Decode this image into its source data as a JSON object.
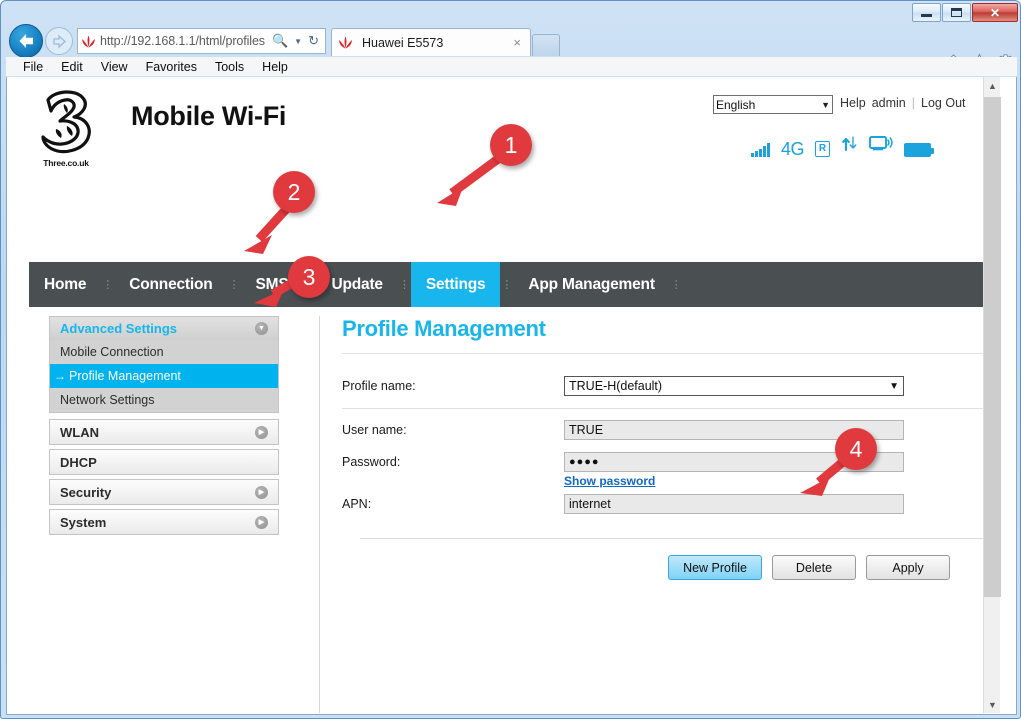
{
  "browser": {
    "window_controls": [
      "minimize",
      "maximize",
      "close"
    ],
    "back_label": "Back",
    "forward_label": "Forward",
    "url": "http://192.168.1.1/html/profiles",
    "url_host": "192.168.1.1",
    "url_scheme": "http://",
    "url_path": "/html/profiles",
    "search_icon": "search-icon",
    "dropdown_icon": "chevron-down-icon",
    "refresh_icon": "refresh-icon",
    "tab": {
      "title": "Huawei E5573",
      "close_label": "×"
    },
    "new_tab_label": "",
    "toolbar_icons": [
      "home-icon",
      "favorites-star-icon",
      "settings-gear-icon"
    ],
    "menu": [
      "File",
      "Edit",
      "View",
      "Favorites",
      "Tools",
      "Help"
    ]
  },
  "header": {
    "logo_text": "Three.co.uk",
    "brand_title": "Mobile Wi-Fi",
    "language": "English",
    "links": {
      "help": "Help",
      "user": "admin",
      "logout": "Log Out"
    },
    "status": {
      "signal": "signal-bars-icon",
      "network": "4G",
      "roaming": "R",
      "traffic": "upload-download-icon",
      "wifi": "wifi-clients-icon",
      "battery": "battery-full-icon"
    }
  },
  "nav": {
    "items": [
      {
        "label": "Home",
        "active": false
      },
      {
        "label": "Connection",
        "active": false
      },
      {
        "label": "SMS",
        "active": false
      },
      {
        "label": "Update",
        "active": false
      },
      {
        "label": "Settings",
        "active": true
      },
      {
        "label": "App Management",
        "active": false
      }
    ]
  },
  "sidebar": {
    "groups": [
      {
        "label": "Advanced Settings",
        "expanded": true,
        "items": [
          {
            "label": "Mobile Connection",
            "selected": false
          },
          {
            "label": "Profile Management",
            "selected": true
          },
          {
            "label": "Network Settings",
            "selected": false
          }
        ]
      },
      {
        "label": "WLAN",
        "expanded": false,
        "items": []
      },
      {
        "label": "DHCP",
        "expanded": false,
        "items": []
      },
      {
        "label": "Security",
        "expanded": false,
        "items": []
      },
      {
        "label": "System",
        "expanded": false,
        "items": []
      }
    ]
  },
  "main": {
    "title": "Profile Management",
    "fields": [
      {
        "label": "Profile name:",
        "value": "TRUE-H(default)",
        "type": "select"
      },
      {
        "label": "User name:",
        "value": "TRUE",
        "type": "text"
      },
      {
        "label": "Password:",
        "value": "●●●●",
        "type": "password"
      },
      {
        "label": "APN:",
        "value": "internet",
        "type": "text"
      }
    ],
    "show_password_link": "Show password",
    "buttons": [
      {
        "label": "New Profile",
        "primary": true
      },
      {
        "label": "Delete",
        "primary": false
      },
      {
        "label": "Apply",
        "primary": false
      }
    ]
  },
  "annotations": [
    {
      "number": "1",
      "target": "Settings"
    },
    {
      "number": "2",
      "target": "Advanced Settings"
    },
    {
      "number": "3",
      "target": "Profile Management"
    },
    {
      "number": "4",
      "target": "New Profile"
    }
  ],
  "colors": {
    "accent": "#19b5ed",
    "nav_bg": "#4a4f51",
    "marker_red": "#e0393e",
    "selected_blue": "#00b3ef",
    "link_blue": "#1168c7"
  }
}
